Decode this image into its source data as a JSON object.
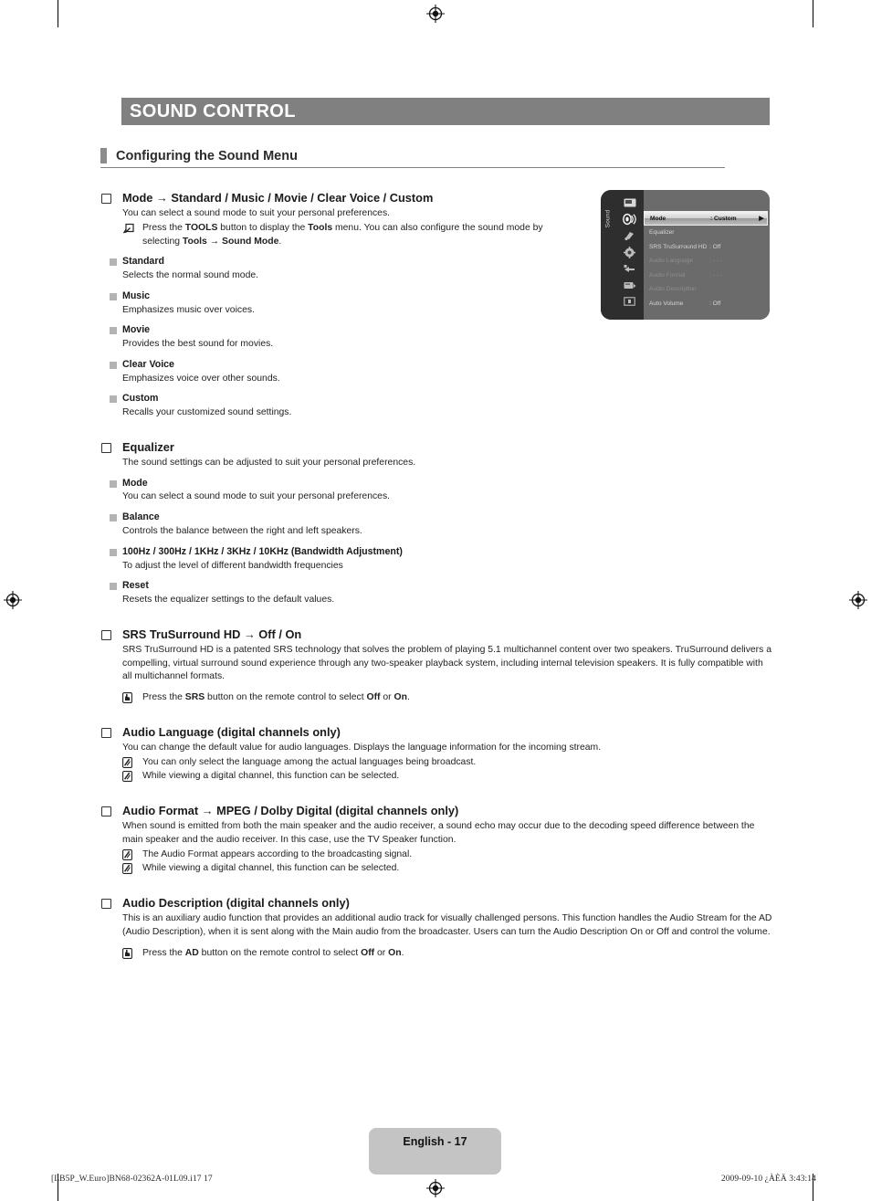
{
  "chapter": {
    "title": "SOUND CONTROL"
  },
  "section": {
    "title": "Configuring the Sound Menu"
  },
  "items": {
    "mode": {
      "heading": "Mode → Standard / Music / Movie / Clear Voice / Custom",
      "desc": "You can select a sound mode to suit your personal preferences.",
      "tools_note": "Press the TOOLS button to display the Tools menu. You can also configure the sound mode by selecting Tools → Sound Mode.",
      "subs": [
        {
          "label": "Standard",
          "desc": "Selects the normal sound mode."
        },
        {
          "label": "Music",
          "desc": "Emphasizes music over voices."
        },
        {
          "label": "Movie",
          "desc": "Provides the best sound for movies."
        },
        {
          "label": "Clear Voice",
          "desc": "Emphasizes voice over other sounds."
        },
        {
          "label": "Custom",
          "desc": "Recalls your customized sound settings."
        }
      ]
    },
    "equalizer": {
      "heading": "Equalizer",
      "desc": "The sound settings can be adjusted to suit your personal preferences.",
      "subs": [
        {
          "label": "Mode",
          "desc": "You can select a sound mode to suit your personal preferences."
        },
        {
          "label": "Balance",
          "desc": "Controls the balance between the right and left speakers."
        },
        {
          "label": "100Hz / 300Hz / 1KHz / 3KHz / 10KHz (Bandwidth Adjustment)",
          "desc": "To adjust the level of different bandwidth frequencies"
        },
        {
          "label": "Reset",
          "desc": "Resets the equalizer settings to the default values."
        }
      ]
    },
    "srs": {
      "heading": "SRS TruSurround HD → Off / On",
      "desc": "SRS TruSurround HD is a patented SRS technology that solves the problem of playing 5.1 multichannel content over two speakers. TruSurround delivers a compelling, virtual surround sound experience through any two-speaker playback system, including internal television speakers. It is fully compatible with all multichannel formats.",
      "remote_note": "Press the SRS button on the remote control to select Off or On."
    },
    "audio_language": {
      "heading": "Audio Language (digital channels only)",
      "desc": "You can change the default value for audio languages. Displays the language information for the incoming stream.",
      "notes": [
        "You can only select the language among the actual languages being broadcast.",
        "While viewing a digital channel, this function can be selected."
      ]
    },
    "audio_format": {
      "heading": "Audio Format → MPEG / Dolby Digital (digital channels only)",
      "desc": "When sound is emitted from both the main speaker and the audio receiver, a sound echo may occur due to the decoding speed difference between the main speaker and the audio receiver. In this case, use the TV Speaker function.",
      "notes": [
        "The Audio Format appears according to the broadcasting signal.",
        "While viewing a digital channel, this function can be selected."
      ]
    },
    "audio_description": {
      "heading": "Audio Description (digital channels only)",
      "desc": "This is an auxiliary audio function that provides an additional audio track for visually challenged persons. This function handles the Audio Stream for the AD (Audio Description), when it is sent along with the Main audio from the broadcaster. Users can turn the Audio Description On or Off and control the volume.",
      "remote_note": "Press the AD button on the remote control to select Off or On."
    }
  },
  "osd": {
    "rail_label": "Sound",
    "icons": [
      "picture-icon",
      "sound-icon",
      "channel-icon",
      "setup-icon",
      "input-icon",
      "application-icon",
      "support-icon"
    ],
    "rows": [
      {
        "label": "Mode",
        "value": ": Custom",
        "arrow": "▶",
        "state": "selected"
      },
      {
        "label": "Equalizer",
        "value": "",
        "arrow": "",
        "state": "normal"
      },
      {
        "label": "SRS TruSurround HD",
        "value": ": Off",
        "arrow": "",
        "state": "normal"
      },
      {
        "label": "Audio Language",
        "value": ": - - -",
        "arrow": "",
        "state": "dim"
      },
      {
        "label": "Audio Format",
        "value": ": - - -",
        "arrow": "",
        "state": "dim"
      },
      {
        "label": "Audio Description",
        "value": "",
        "arrow": "",
        "state": "dim"
      },
      {
        "label": "Auto Volume",
        "value": ": Off",
        "arrow": "",
        "state": "normal"
      }
    ]
  },
  "footer": {
    "page_label": "English - 17",
    "print_id": "[LB5P_W.Euro]BN68-02362A-01L09.i17   17",
    "timestamp": "2009-09-10   ¿ÀÈÄ 3:43:14"
  },
  "colors": {
    "chapter_bar": "#808080",
    "section_marker": "#8c8c8c",
    "page_tab": "#c4c4c4",
    "osd_panel": "#6b6b6b",
    "osd_rail": "#2e2e2e"
  }
}
